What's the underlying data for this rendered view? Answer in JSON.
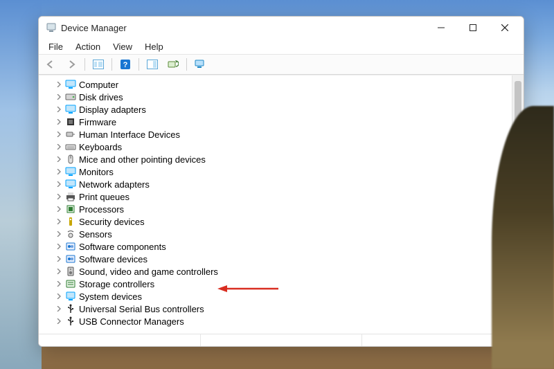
{
  "window": {
    "title": "Device Manager"
  },
  "menu": {
    "file": "File",
    "action": "Action",
    "view": "View",
    "help": "Help"
  },
  "devices": [
    {
      "key": "computer",
      "label": "Computer",
      "icon": "monitor",
      "color": "#00a2ff"
    },
    {
      "key": "disk-drives",
      "label": "Disk drives",
      "icon": "disk",
      "color": "#555"
    },
    {
      "key": "display-adapters",
      "label": "Display adapters",
      "icon": "monitor",
      "color": "#00a2ff"
    },
    {
      "key": "firmware",
      "label": "Firmware",
      "icon": "chip",
      "color": "#444"
    },
    {
      "key": "hid",
      "label": "Human Interface Devices",
      "icon": "hid",
      "color": "#6b6b6b"
    },
    {
      "key": "keyboards",
      "label": "Keyboards",
      "icon": "keyboard",
      "color": "#555"
    },
    {
      "key": "mice",
      "label": "Mice and other pointing devices",
      "icon": "mouse",
      "color": "#555"
    },
    {
      "key": "monitors",
      "label": "Monitors",
      "icon": "monitor",
      "color": "#00a2ff"
    },
    {
      "key": "network",
      "label": "Network adapters",
      "icon": "monitor",
      "color": "#00a2ff"
    },
    {
      "key": "print-queues",
      "label": "Print queues",
      "icon": "printer",
      "color": "#3a3a3a"
    },
    {
      "key": "processors",
      "label": "Processors",
      "icon": "cpu",
      "color": "#2e7d32"
    },
    {
      "key": "security",
      "label": "Security devices",
      "icon": "security",
      "color": "#c7a600"
    },
    {
      "key": "sensors",
      "label": "Sensors",
      "icon": "sensor",
      "color": "#333"
    },
    {
      "key": "sw-components",
      "label": "Software components",
      "icon": "sw",
      "color": "#1976d2"
    },
    {
      "key": "sw-devices",
      "label": "Software devices",
      "icon": "sw",
      "color": "#1976d2"
    },
    {
      "key": "sound",
      "label": "Sound, video and game controllers",
      "icon": "speaker",
      "color": "#616161",
      "highlight": true
    },
    {
      "key": "storage",
      "label": "Storage controllers",
      "icon": "storage",
      "color": "#2e7d32"
    },
    {
      "key": "system",
      "label": "System devices",
      "icon": "system",
      "color": "#00a2ff"
    },
    {
      "key": "usb",
      "label": "Universal Serial Bus controllers",
      "icon": "usb",
      "color": "#222"
    },
    {
      "key": "usb-connector",
      "label": "USB Connector Managers",
      "icon": "usb",
      "color": "#222"
    }
  ],
  "annotation_arrow_color": "#d92d20"
}
